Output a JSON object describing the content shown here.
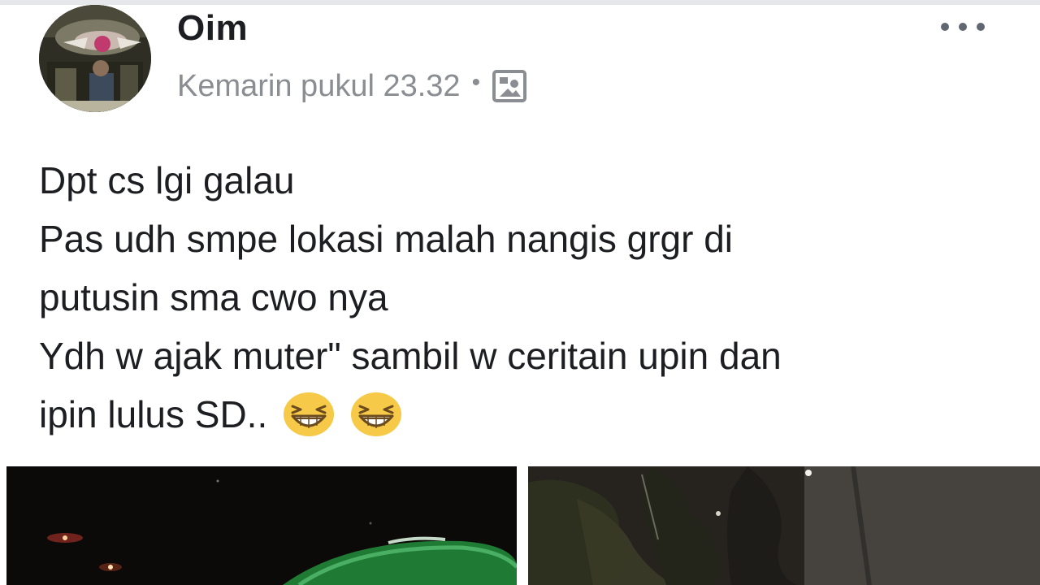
{
  "post": {
    "author": "Oim",
    "timestamp": "Kemarin pukul 23.32",
    "separator": "•",
    "audience_icon": "photo-album-icon",
    "more_icon": "more-options-icon",
    "lines": [
      "Dpt cs lgi galau",
      "Pas udh smpe lokasi malah nangis grgr di",
      "putusin sma cwo nya",
      "Ydh w ajak muter\" sambil w ceritain upin dan",
      "ipin lulus SD.."
    ],
    "emoji": [
      "grinning-squinting-face-emoji",
      "grinning-squinting-face-emoji"
    ]
  },
  "photos": [
    {
      "description_icon": "night-street-photo"
    },
    {
      "description_icon": "night-trees-photo"
    }
  ],
  "colors": {
    "author": "#1c1e21",
    "meta": "#8a8d91",
    "body_text": "#1c1e21",
    "emoji_yellow": "#f7c948"
  }
}
